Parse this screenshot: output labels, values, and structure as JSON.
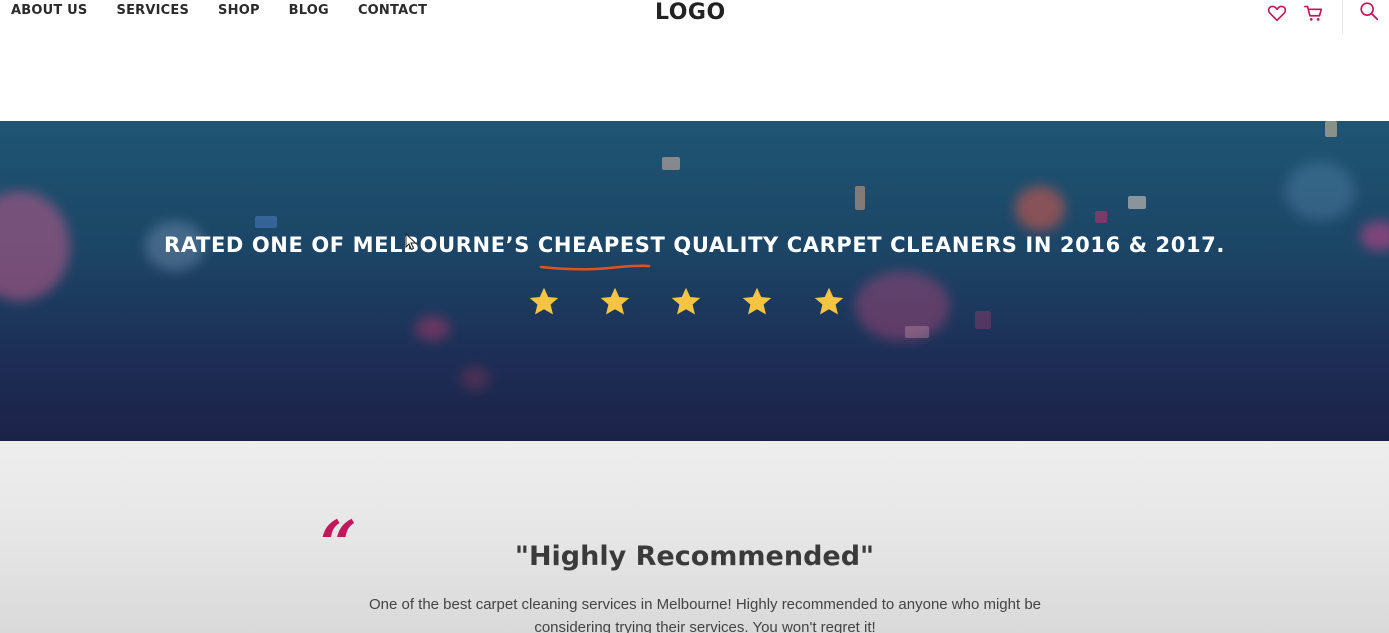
{
  "header": {
    "nav": [
      "ABOUT US",
      "SERVICES",
      "SHOP",
      "BLOG",
      "CONTACT"
    ],
    "logo": "LOGO",
    "icons": [
      "heart-icon",
      "cart-icon",
      "search-icon"
    ],
    "accent_color": "#c2185b"
  },
  "hero": {
    "title": "RATED ONE OF MELBOURNE’S CHEAPEST QUALITY CARPET CLEANERS IN 2016 & 2017.",
    "rating_stars": 5,
    "star_color": "#f5c542",
    "highlight_color": "#e0531f"
  },
  "testimonial": {
    "quote_mark": "“",
    "title": "\"Highly Recommended\"",
    "body": "One of the best carpet cleaning services in Melbourne! Highly recommended to anyone who might be considering trying their services. You won't regret it!"
  }
}
